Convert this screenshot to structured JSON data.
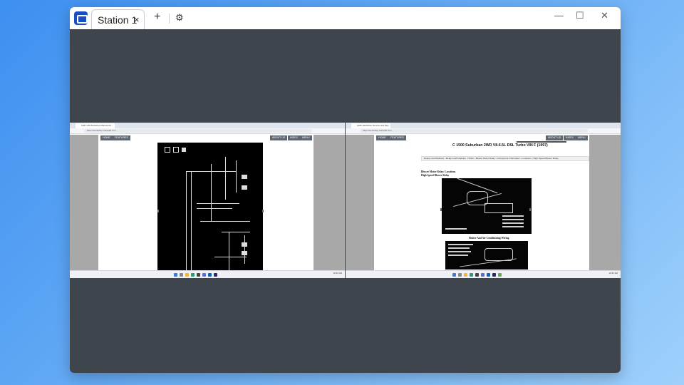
{
  "window": {
    "tab_label": "Station 1",
    "tab_close": "×",
    "new_tab": "+",
    "settings_icon": "⚙",
    "minimize": "—",
    "maximize": "☐",
    "close": "✕"
  },
  "left_screen": {
    "tab_title": "1987 GM Workshop Manual Ch...",
    "url": "https://workshop-manuals.com",
    "nav": [
      "HOME",
      "FEATURES",
      "ABOUT US",
      "INDEX",
      "MENU"
    ],
    "clock": "10:31 AM"
  },
  "right_screen": {
    "tab_title": "GMC Workshop Service and Rep...",
    "url": "https://workshop-manuals.com",
    "nav": [
      "HOME",
      "FEATURES",
      "ABOUT US",
      "INDEX",
      "MENU"
    ],
    "doc_title": "C 1500 Suburban 2WD V8-6.5L DSL Turbo VIN F (1997)",
    "breadcrumbs": "Relays and Modules › Relays and Modules - HVAC › Blower Motor Relay › Component Information › Locations › High Speed Blower Relay",
    "heading_1": "Blower Motor Relay: Locations",
    "heading_2": "High Speed Blower Relay",
    "heading_3": "Heater And Air Conditioning Wiring",
    "clock": "10:31 AM"
  },
  "colors": {
    "window_bg": "#3f454d",
    "accent": "#1a4fc4"
  }
}
